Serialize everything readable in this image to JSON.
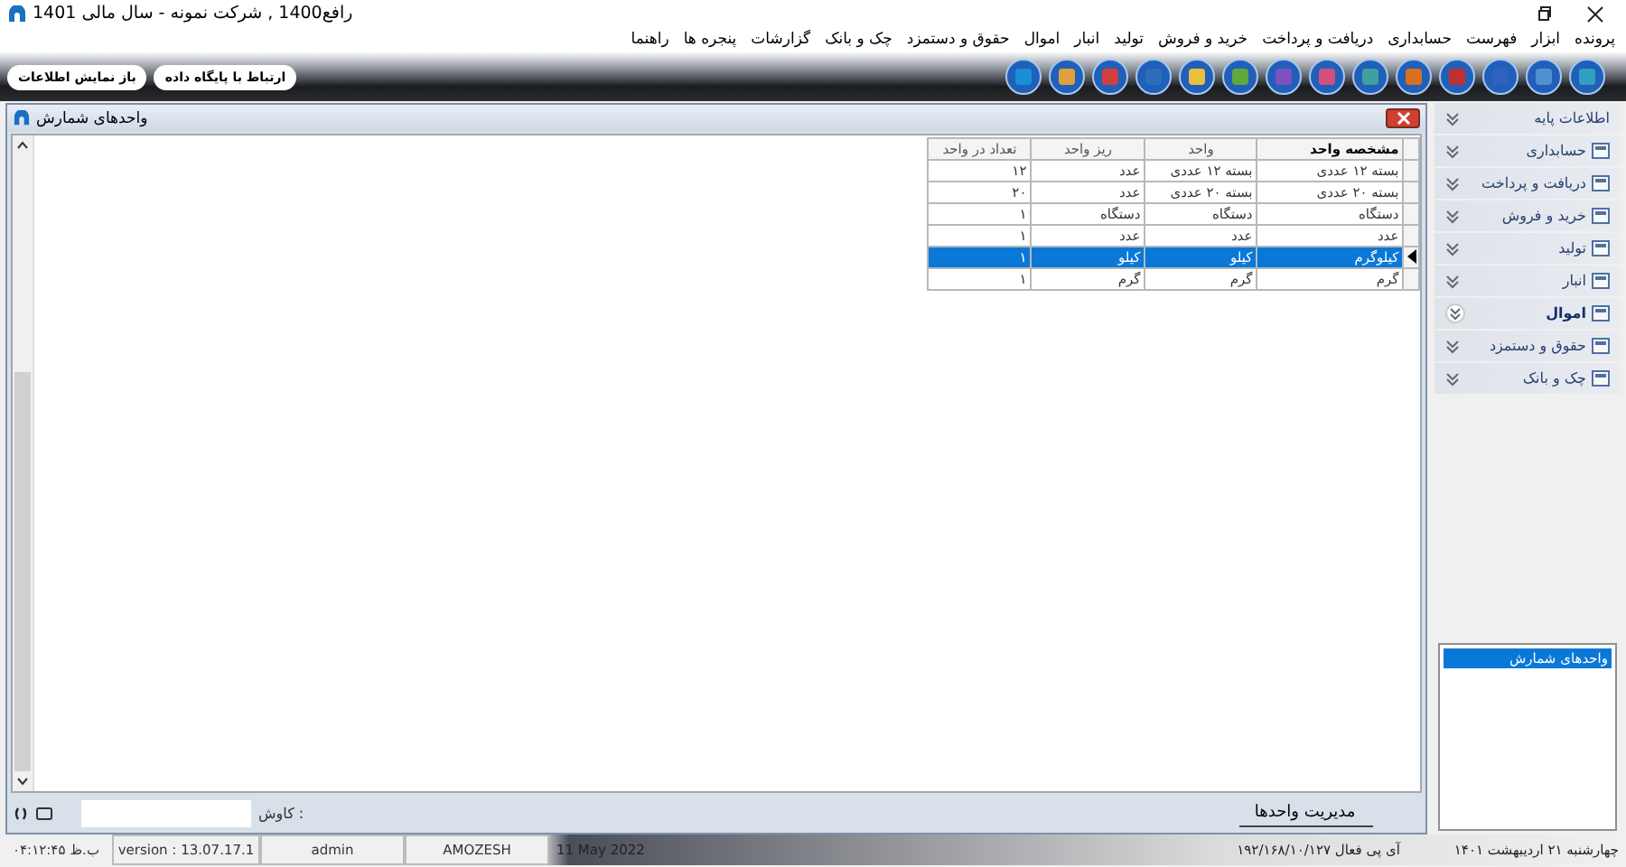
{
  "window": {
    "title": "رافع1400 , شرکت نمونه - سال مالی 1401"
  },
  "menu": [
    "پرونده",
    "ابزار",
    "فهرست",
    "حسابداری",
    "دریافت و پرداخت",
    "خرید و فروش",
    "تولید",
    "انبار",
    "اموال",
    "حقوق و دستمزد",
    "چک و بانک",
    "گزارشات",
    "پنجره ها",
    "راهنما"
  ],
  "toolbar_buttons": [
    "ارتباط با پایگاه داده",
    "باز نمایش اطلاعات"
  ],
  "child_window": {
    "title": "واحدهای شمارش",
    "table": {
      "columns": [
        "مشخصه واحد",
        "واحد",
        "ریز واحد",
        "تعداد در واحد"
      ],
      "rows": [
        {
          "cells": [
            "بسته ۱۲ عددی",
            "بسته ۱۲ عددی",
            "عدد",
            "۱۲"
          ],
          "selected": false
        },
        {
          "cells": [
            "بسته ۲۰ عددی",
            "بسته ۲۰ عددی",
            "عدد",
            "۲۰"
          ],
          "selected": false
        },
        {
          "cells": [
            "دستگاه",
            "دستگاه",
            "دستگاه",
            "۱"
          ],
          "selected": false
        },
        {
          "cells": [
            "عدد",
            "عدد",
            "عدد",
            "۱"
          ],
          "selected": false
        },
        {
          "cells": [
            "کیلوگرم",
            "کیلو",
            "کیلو",
            "۱"
          ],
          "selected": true
        },
        {
          "cells": [
            "گرم",
            "گرم",
            "گرم",
            "۱"
          ],
          "selected": false
        }
      ]
    },
    "tab": "مدیریت واحدها",
    "search_label": "کاوش :"
  },
  "sidebar": {
    "items": [
      {
        "label": "اطلاعات پایه",
        "highlighted": false
      },
      {
        "label": "حسابداری",
        "highlighted": false
      },
      {
        "label": "دریافت و پرداخت",
        "highlighted": false
      },
      {
        "label": "خرید و فروش",
        "highlighted": false
      },
      {
        "label": "تولید",
        "highlighted": false
      },
      {
        "label": "انبار",
        "highlighted": false
      },
      {
        "label": "اموال",
        "highlighted": true
      },
      {
        "label": "حقوق و دستمزد",
        "highlighted": false
      },
      {
        "label": "چک و بانک",
        "highlighted": false
      }
    ],
    "open_windows": [
      {
        "label": "واحدهای شمارش",
        "selected": true
      }
    ]
  },
  "status_bar": {
    "time": "ب.ظ ۰۴:۱۲:۴۵",
    "version": "version : 13.07.17.1",
    "user": "admin",
    "database": "AMOZESH",
    "date": "11 May 2022",
    "ip": "آی پی فعال ۱۹۲/۱۶۸/۱۰/۱۲۷",
    "persian_date": "چهارشنبه ۲۱ اردیبهشت ۱۴۰۱"
  }
}
